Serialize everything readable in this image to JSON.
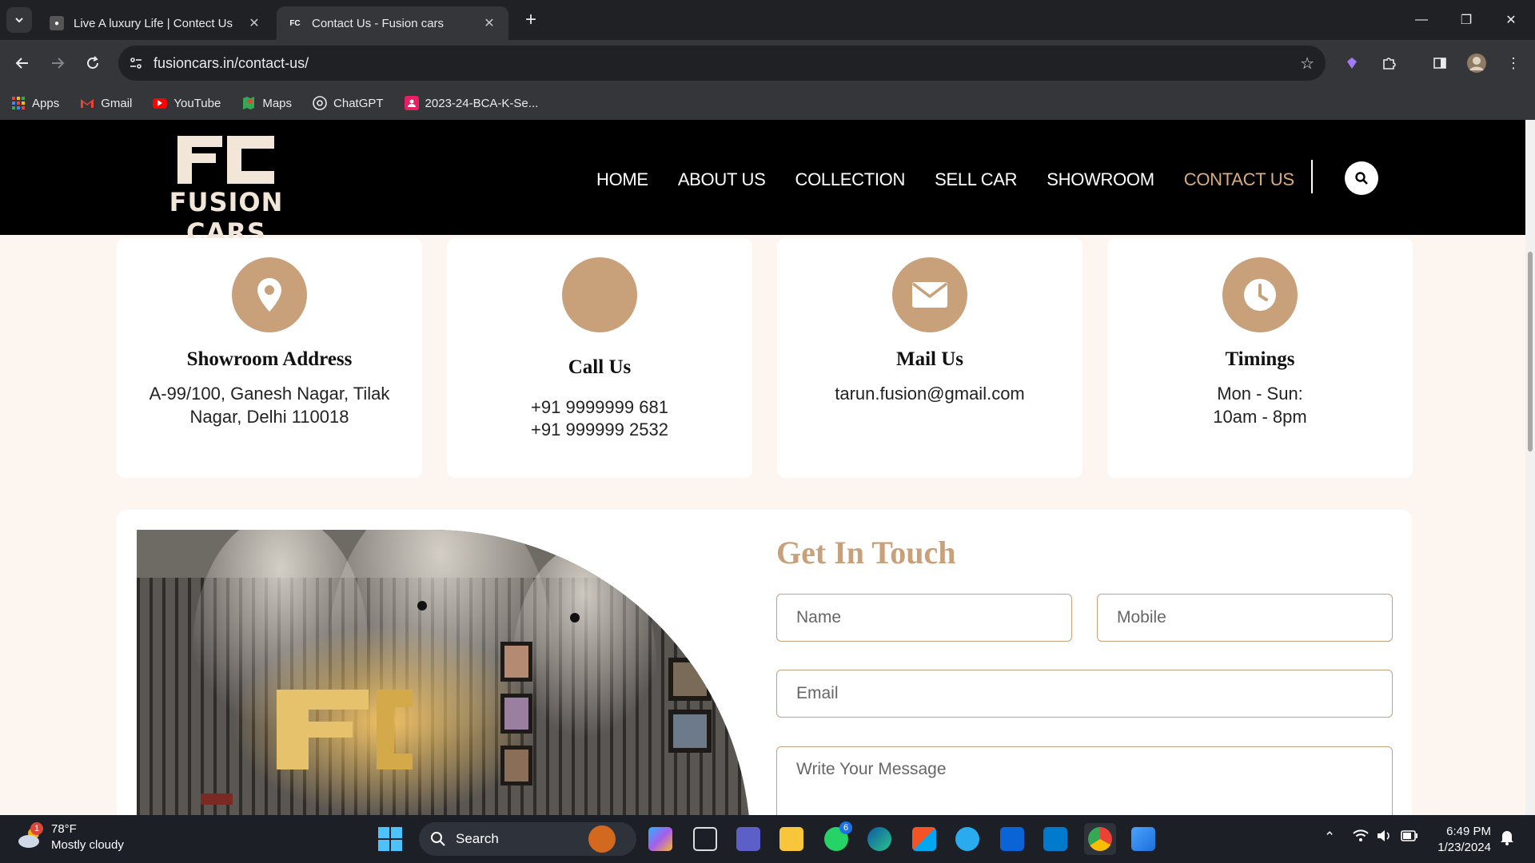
{
  "browser": {
    "tabs": [
      {
        "title": "Live A luxury Life | Contect Us",
        "active": false
      },
      {
        "title": "Contact Us - Fusion cars",
        "active": true
      }
    ],
    "url": "fusioncars.in/contact-us/",
    "bookmarks": [
      "Apps",
      "Gmail",
      "YouTube",
      "Maps",
      "ChatGPT",
      "2023-24-BCA-K-Se..."
    ]
  },
  "site": {
    "logo_text": "FUSION CARS",
    "nav": [
      "HOME",
      "ABOUT US",
      "COLLECTION",
      "SELL CAR",
      "SHOWROOM",
      "CONTACT US"
    ],
    "accent_color": "#c8a07a",
    "cards": [
      {
        "title": "Showroom Address",
        "lines": [
          "A-99/100, Ganesh Nagar, Tilak",
          "Nagar, Delhi 110018"
        ],
        "icon": "location-pin-icon"
      },
      {
        "title": "Call Us",
        "lines": [
          "+91 9999999 681",
          "+91 999999 2532"
        ],
        "icon": "phone-icon"
      },
      {
        "title": "Mail Us",
        "lines": [
          "tarun.fusion@gmail.com"
        ],
        "icon": "mail-icon"
      },
      {
        "title": "Timings",
        "lines": [
          "Mon - Sun:",
          "10am - 8pm"
        ],
        "icon": "clock-icon"
      }
    ],
    "form": {
      "title": "Get In Touch",
      "name_placeholder": "Name",
      "mobile_placeholder": "Mobile",
      "email_placeholder": "Email",
      "message_placeholder": "Write Your Message"
    }
  },
  "taskbar": {
    "weather_temp": "78°F",
    "weather_desc": "Mostly cloudy",
    "weather_badge": "1",
    "search_label": "Search",
    "whatsapp_badge": "6",
    "time": "6:49 PM",
    "date": "1/23/2024"
  }
}
